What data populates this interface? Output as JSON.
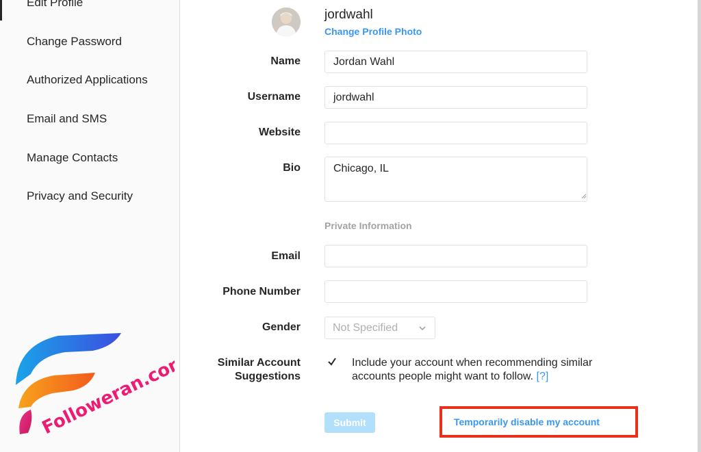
{
  "sidebar": {
    "items": [
      {
        "label": "Edit Profile"
      },
      {
        "label": "Change Password"
      },
      {
        "label": "Authorized Applications"
      },
      {
        "label": "Email and SMS"
      },
      {
        "label": "Manage Contacts"
      },
      {
        "label": "Privacy and Security"
      }
    ]
  },
  "profile": {
    "username": "jordwahl",
    "change_photo": "Change Profile Photo"
  },
  "form": {
    "name_label": "Name",
    "name_value": "Jordan Wahl",
    "username_label": "Username",
    "username_value": "jordwahl",
    "website_label": "Website",
    "website_value": "",
    "bio_label": "Bio",
    "bio_value": "Chicago, IL",
    "private_header": "Private Information",
    "email_label": "Email",
    "email_value": "",
    "phone_label": "Phone Number",
    "phone_value": "",
    "gender_label": "Gender",
    "gender_value": "Not Specified",
    "similar_label_1": "Similar Account",
    "similar_label_2": "Suggestions",
    "similar_checked": true,
    "similar_text": "Include your account when recommending similar accounts people might want to follow.",
    "help_link": "[?]",
    "submit": "Submit",
    "disable_link": "Temporarily disable my account"
  },
  "watermark": {
    "text": "Followeran.com"
  },
  "colors": {
    "link": "#3897f0",
    "highlight": "#e8301b",
    "submit_disabled": "#b2dffc"
  }
}
